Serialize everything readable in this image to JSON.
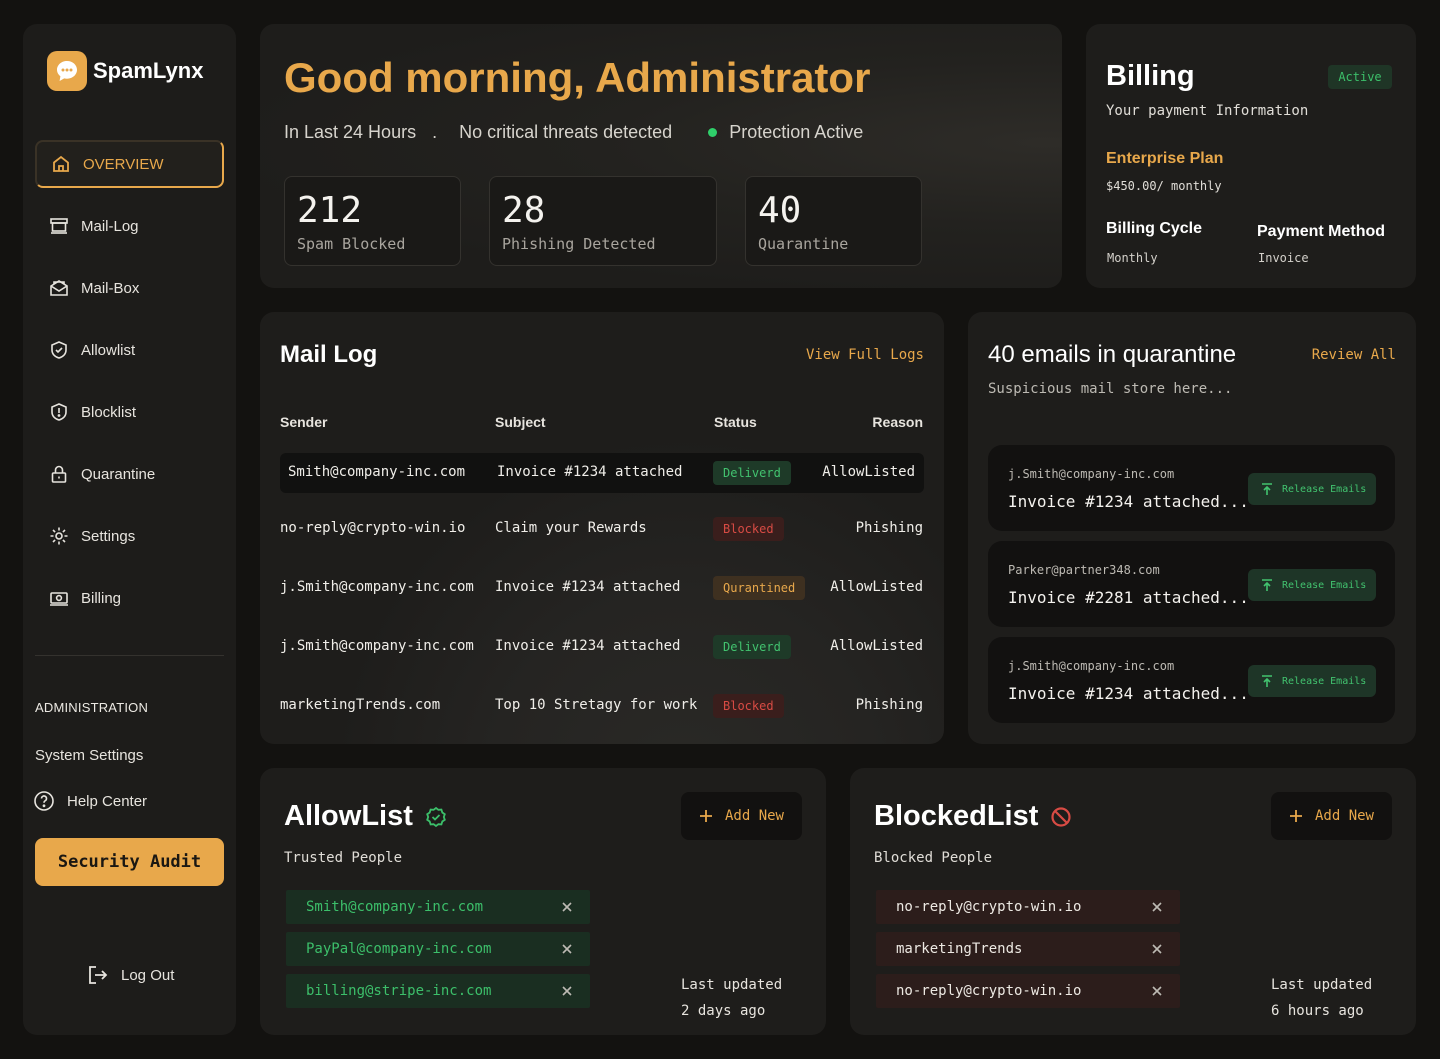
{
  "app": {
    "name": "SpamLynx"
  },
  "sidebar": {
    "items": [
      {
        "label": "OVERVIEW",
        "icon": "home-icon",
        "active": true
      },
      {
        "label": "Mail-Log",
        "icon": "inbox-icon"
      },
      {
        "label": "Mail-Box",
        "icon": "mailbox-icon"
      },
      {
        "label": "Allowlist",
        "icon": "shield-check-icon"
      },
      {
        "label": "Blocklist",
        "icon": "shield-alert-icon"
      },
      {
        "label": "Quarantine",
        "icon": "lock-icon"
      },
      {
        "label": "Settings",
        "icon": "gear-icon"
      },
      {
        "label": "Billing",
        "icon": "billing-icon"
      }
    ],
    "admin_label": "ADMINISTRATION",
    "system_settings": "System Settings",
    "help_center": "Help Center",
    "security_audit": "Security Audit",
    "logout": "Log Out"
  },
  "greeting": {
    "title": "Good morning, Administrator",
    "period": "In Last 24 Hours",
    "separator": ".",
    "threats": "No critical threats detected",
    "protection": "Protection Active",
    "stats": [
      {
        "value": "212",
        "label": "Spam Blocked"
      },
      {
        "value": "28",
        "label": "Phishing Detected"
      },
      {
        "value": "40",
        "label": "Quarantine"
      }
    ]
  },
  "billing": {
    "title": "Billing",
    "status": "Active",
    "subtitle": "Your payment Information",
    "plan": "Enterprise Plan",
    "price": "$450.00/ monthly",
    "cycle_label": "Billing Cycle",
    "cycle_value": "Monthly",
    "method_label": "Payment Method",
    "method_value": "Invoice"
  },
  "maillog": {
    "title": "Mail Log",
    "link": "View Full Logs",
    "columns": [
      "Sender",
      "Subject",
      "Status",
      "Reason"
    ],
    "rows": [
      {
        "sender": "Smith@company-inc.com",
        "subject": "Invoice #1234 attached",
        "status": "Deliverd",
        "reason": "AllowListed"
      },
      {
        "sender": "no-reply@crypto-win.io",
        "subject": "Claim your Rewards",
        "status": "Blocked",
        "reason": "Phishing"
      },
      {
        "sender": "j.Smith@company-inc.com",
        "subject": "Invoice #1234 attached",
        "status": "Qurantined",
        "reason": "AllowListed"
      },
      {
        "sender": "j.Smith@company-inc.com",
        "subject": "Invoice #1234 attached",
        "status": "Deliverd",
        "reason": "AllowListed"
      },
      {
        "sender": "marketingTrends.com",
        "subject": "Top 10 Stretagy for work",
        "status": "Blocked",
        "reason": "Phishing"
      }
    ]
  },
  "quarantine": {
    "title": "40 emails in quarantine",
    "link": "Review All",
    "subtitle": "Suspicious mail store here...",
    "items": [
      {
        "sender": "j.Smith@company-inc.com",
        "subject": "Invoice #1234 attached...",
        "action": "Release Emails"
      },
      {
        "sender": "Parker@partner348.com",
        "subject": "Invoice #2281 attached...",
        "action": "Release Emails"
      },
      {
        "sender": "j.Smith@company-inc.com",
        "subject": "Invoice #1234 attached...",
        "action": "Release Emails"
      }
    ]
  },
  "allowlist": {
    "title": "AllowList",
    "subtitle": "Trusted People",
    "add": "Add New",
    "items": [
      "Smith@company-inc.com",
      "PayPal@company-inc.com",
      "billing@stripe-inc.com"
    ],
    "updated_label": "Last updated",
    "updated_value": "2 days ago"
  },
  "blockedlist": {
    "title": "BlockedList",
    "subtitle": "Blocked People",
    "add": "Add New",
    "items": [
      "no-reply@crypto-win.io",
      "marketingTrends",
      "no-reply@crypto-win.io"
    ],
    "updated_label": "Last updated",
    "updated_value": "6 hours ago"
  },
  "colors": {
    "accent": "#e8a84b",
    "success": "#42c36f",
    "danger": "#d84b44",
    "background": "#131210",
    "card": "#1e1d1b"
  }
}
